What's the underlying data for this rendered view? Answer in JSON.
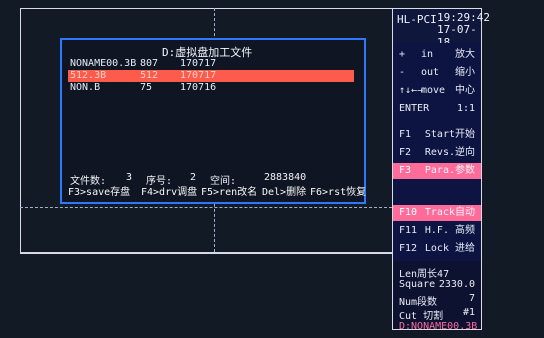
{
  "dialog": {
    "title": "D:虚拟盘加工文件",
    "files": [
      {
        "name": "NONAME00.3B",
        "size": "807",
        "date": "170717"
      },
      {
        "name": "512.3B",
        "size": "512",
        "date": "170717"
      },
      {
        "name": "NON.B",
        "size": "75",
        "date": "170716"
      }
    ],
    "status": {
      "count_label": "文件数:",
      "count_value": "3",
      "index_label": "序号:",
      "index_value": "2",
      "space_label": "空间:",
      "space_value": "2883840"
    }
  },
  "command_line": {
    "save": "F3>save存盘",
    "drv": "F4>drv调盘",
    "ren": "F5>ren改名",
    "del": "Del>删除",
    "rst": "F6>rst恢复"
  },
  "panel": {
    "header_left": "HL-PCI",
    "time": "19:29:42",
    "date": "17-07-18",
    "nav": [
      {
        "key": "+",
        "action": "in",
        "label": "放大"
      },
      {
        "key": "-",
        "action": "out",
        "label": "缩小"
      },
      {
        "key": "↑↓←→",
        "action": "move",
        "label": "中心"
      },
      {
        "key": "ENTER",
        "action": "",
        "label": "1:1"
      }
    ],
    "menu": [
      {
        "key": "F1",
        "label": "Start开始"
      },
      {
        "key": "F2",
        "label": "Revs.逆向"
      },
      {
        "key": "F3",
        "label": "Para.参数"
      },
      {
        "key": "F10",
        "label": "Track自动"
      },
      {
        "key": "F11",
        "label": "H.F. 高频"
      },
      {
        "key": "F12",
        "label": "Lock 进给"
      }
    ],
    "info": [
      {
        "label": "Len周长47",
        "value": ""
      },
      {
        "label": "Square",
        "value": "2330.0"
      },
      {
        "label": "Num段数",
        "value": "7"
      },
      {
        "label": "Cut 切割",
        "value": "#1"
      },
      {
        "label": "D:NONAME00.3B",
        "value": ""
      }
    ]
  }
}
